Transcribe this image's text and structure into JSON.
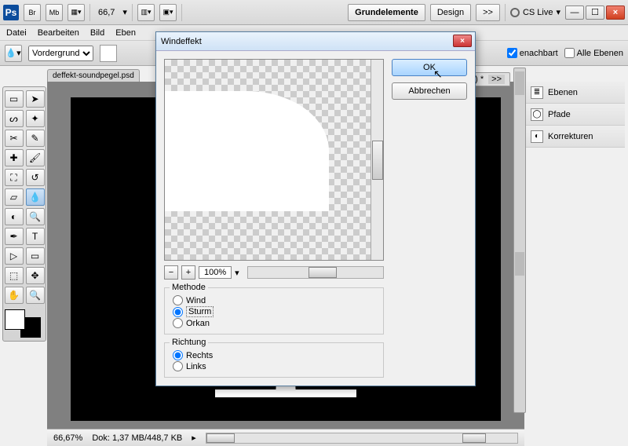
{
  "appbar": {
    "zoom": "66,7",
    "workspace_primary": "Grundelemente",
    "workspace_secondary": "Design",
    "more": ">>",
    "cslive": "CS Live"
  },
  "window_controls": {
    "min": "—",
    "max": "☐",
    "close": "×"
  },
  "menu": {
    "file": "Datei",
    "edit": "Bearbeiten",
    "image": "Bild",
    "layer_trunc": "Eben"
  },
  "optbar": {
    "mode_label": "Vordergrund",
    "adjacent": "enachbart",
    "all_layers": "Alle Ebenen"
  },
  "doc_tab": "deffekt-soundpegel.psd",
  "right_tab": "3) *",
  "right_tab_more": ">>",
  "panels": {
    "layers": "Ebenen",
    "paths": "Pfade",
    "adjust": "Korrekturen"
  },
  "dialog": {
    "title": "Windeffekt",
    "ok": "OK",
    "cancel": "Abbrechen",
    "zoom": "100%",
    "method_legend": "Methode",
    "method_wind": "Wind",
    "method_sturm": "Sturm",
    "method_orkan": "Orkan",
    "dir_legend": "Richtung",
    "dir_right": "Rechts",
    "dir_left": "Links"
  },
  "status": {
    "zoom": "66,67%",
    "doc": "Dok: 1,37 MB/448,7 KB"
  }
}
